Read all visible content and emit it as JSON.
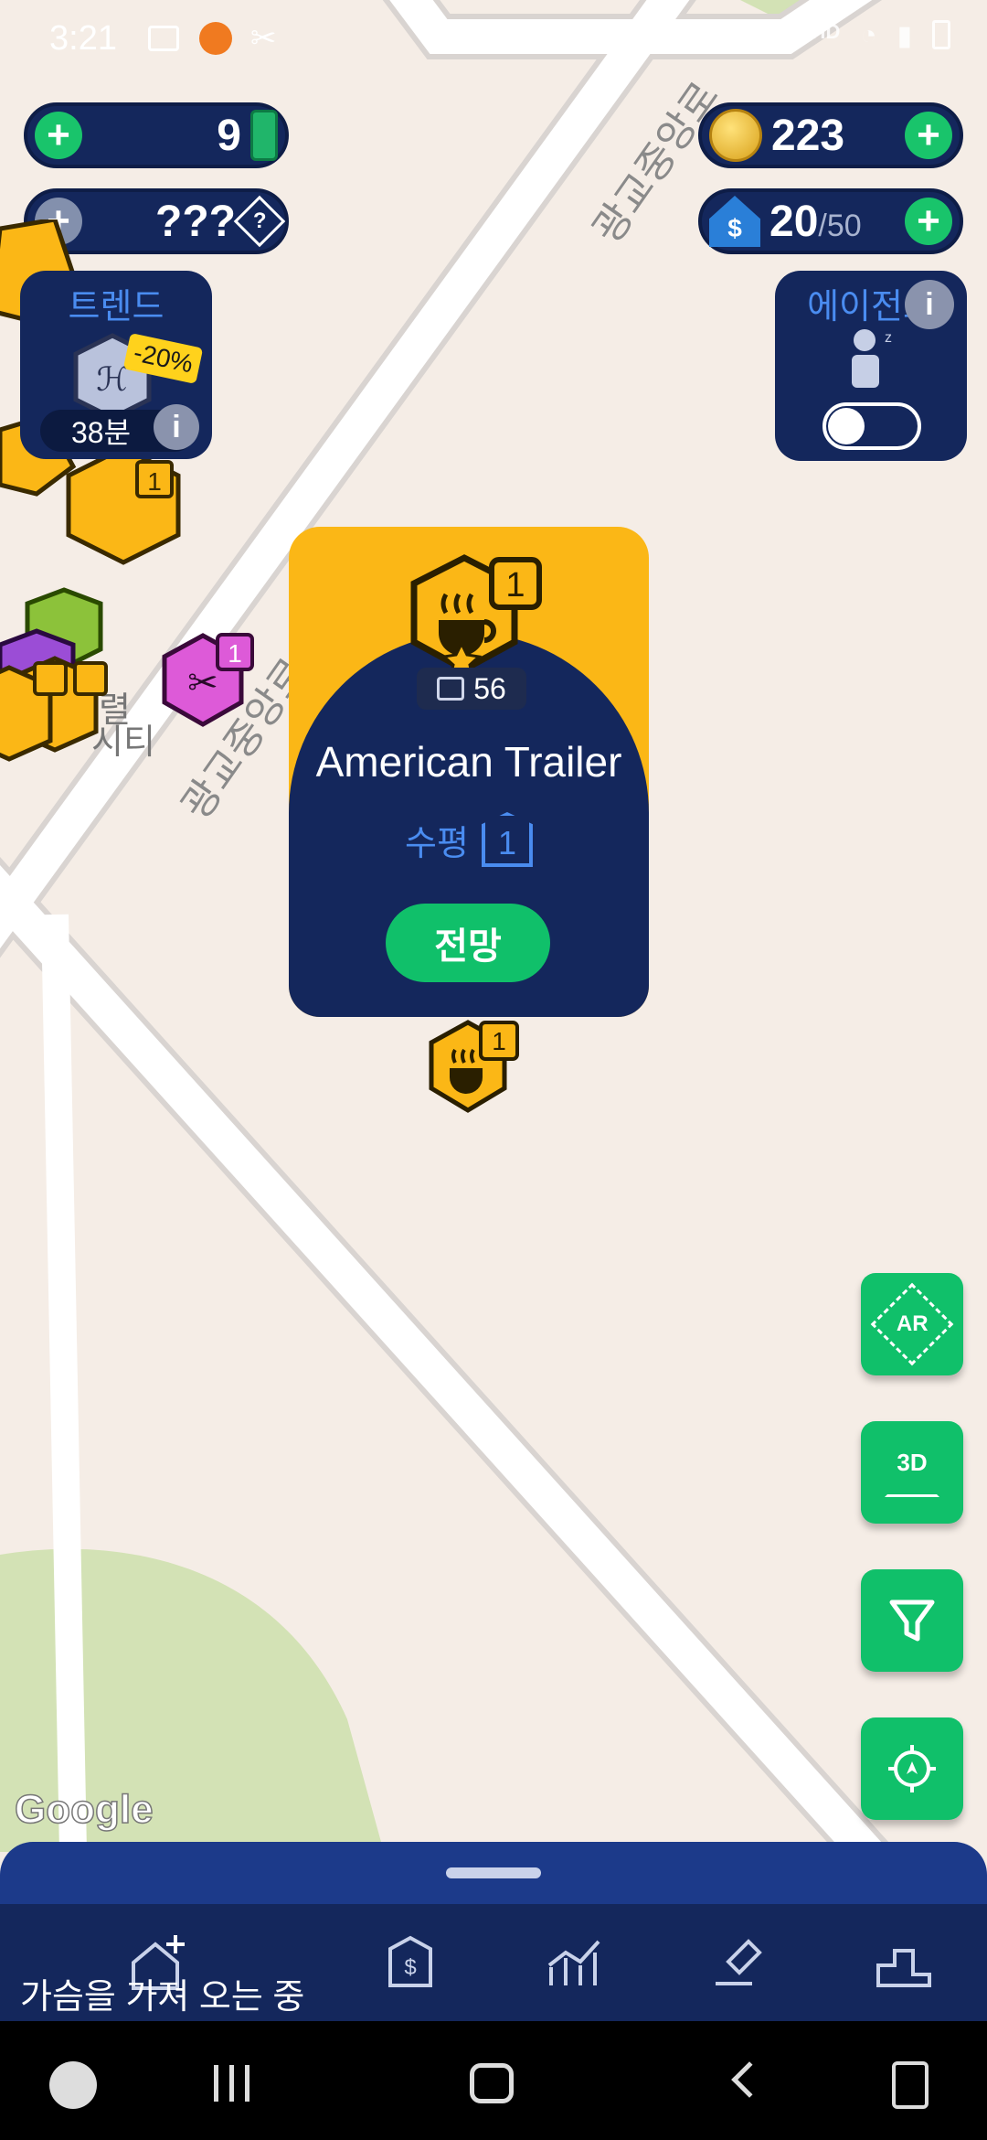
{
  "status_bar": {
    "time": "3:21"
  },
  "resources": {
    "cash": "9",
    "unknown": "???",
    "coins": "223",
    "properties_current": "20",
    "properties_max": "/50"
  },
  "trend": {
    "title": "트렌드",
    "discount": "-20%",
    "timer": "38분"
  },
  "agent": {
    "title": "에이전트"
  },
  "map": {
    "road_label_1": "광교중앙로",
    "road_label_2": "광교중앙로",
    "area_label_1": "렬",
    "area_label_2": "시티",
    "attribution": "Google"
  },
  "business_card": {
    "level_badge": "1",
    "visitors": "56",
    "name": "American Trailer",
    "level_label": "수평",
    "level_value": "1",
    "action_label": "전망"
  },
  "fab": {
    "ar": "AR",
    "three_d": "3D"
  },
  "bottom_sheet": {
    "loading_text": "가슴을 가져 오는 중"
  },
  "colors": {
    "accent_green": "#19c46b",
    "panel_blue": "#14275c",
    "card_gold": "#fbb716",
    "fab_green": "#10c06a"
  }
}
